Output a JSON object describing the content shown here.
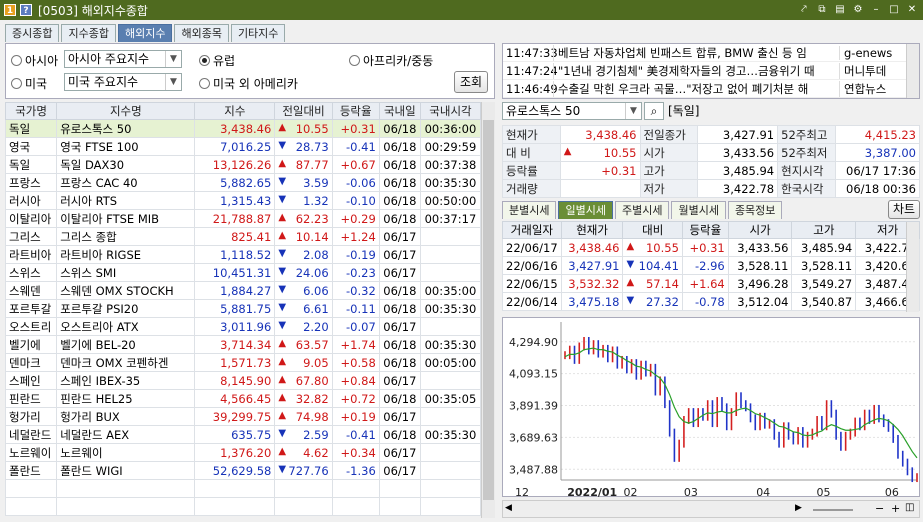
{
  "window": {
    "title": "[0503] 해외지수종합"
  },
  "top_tabs": [
    "증시종합",
    "지수종합",
    "해외지수",
    "해외종목",
    "기타지수"
  ],
  "filters": {
    "asia_label": "아시아",
    "asia_select": "아시아 주요지수",
    "europe_label": "유럽",
    "africa_label": "아프리카/중동",
    "us_label": "미국",
    "us_select": "미국 주요지수",
    "nonus_label": "미국 외 아메리카",
    "query_button": "조회"
  },
  "list_headers": [
    "국가명",
    "지수명",
    "지수",
    "전일대비",
    "등락율",
    "국내일",
    "국내시각"
  ],
  "list_rows": [
    {
      "country": "독일",
      "name": "유로스톡스 50",
      "value": "3,438.46",
      "dir": "up",
      "chg": "10.55",
      "rate": "+0.31",
      "date": "06/18",
      "time": "00:36:00"
    },
    {
      "country": "영국",
      "name": "영국 FTSE 100",
      "value": "7,016.25",
      "dir": "dn",
      "chg": "28.73",
      "rate": "-0.41",
      "date": "06/18",
      "time": "00:29:59"
    },
    {
      "country": "독일",
      "name": "독일 DAX30",
      "value": "13,126.26",
      "dir": "up",
      "chg": "87.77",
      "rate": "+0.67",
      "date": "06/18",
      "time": "00:37:38"
    },
    {
      "country": "프랑스",
      "name": "프랑스 CAC 40",
      "value": "5,882.65",
      "dir": "dn",
      "chg": "3.59",
      "rate": "-0.06",
      "date": "06/18",
      "time": "00:35:30"
    },
    {
      "country": "러시아",
      "name": "러시아 RTS",
      "value": "1,315.43",
      "dir": "dn",
      "chg": "1.32",
      "rate": "-0.10",
      "date": "06/18",
      "time": "00:50:00"
    },
    {
      "country": "이탈리아",
      "name": "이탈리아 FTSE MIB",
      "value": "21,788.87",
      "dir": "up",
      "chg": "62.23",
      "rate": "+0.29",
      "date": "06/18",
      "time": "00:37:17"
    },
    {
      "country": "그리스",
      "name": "그리스 종합",
      "value": "825.41",
      "dir": "up",
      "chg": "10.14",
      "rate": "+1.24",
      "date": "06/17",
      "time": ""
    },
    {
      "country": "라트비아",
      "name": "라트비아 RIGSE",
      "value": "1,118.52",
      "dir": "dn",
      "chg": "2.08",
      "rate": "-0.19",
      "date": "06/17",
      "time": ""
    },
    {
      "country": "스위스",
      "name": "스위스 SMI",
      "value": "10,451.31",
      "dir": "dn",
      "chg": "24.06",
      "rate": "-0.23",
      "date": "06/17",
      "time": ""
    },
    {
      "country": "스웨덴",
      "name": "스웨덴 OMX STOCKH",
      "value": "1,884.27",
      "dir": "dn",
      "chg": "6.06",
      "rate": "-0.32",
      "date": "06/18",
      "time": "00:35:00"
    },
    {
      "country": "포르투갈",
      "name": "포르투갈 PSI20",
      "value": "5,881.75",
      "dir": "dn",
      "chg": "6.61",
      "rate": "-0.11",
      "date": "06/18",
      "time": "00:35:30"
    },
    {
      "country": "오스트리",
      "name": "오스트리아 ATX",
      "value": "3,011.96",
      "dir": "dn",
      "chg": "2.20",
      "rate": "-0.07",
      "date": "06/17",
      "time": ""
    },
    {
      "country": "벨기에",
      "name": "벨기에 BEL-20",
      "value": "3,714.34",
      "dir": "up",
      "chg": "63.57",
      "rate": "+1.74",
      "date": "06/18",
      "time": "00:35:30"
    },
    {
      "country": "덴마크",
      "name": "덴마크 OMX 코펜하겐",
      "value": "1,571.73",
      "dir": "up",
      "chg": "9.05",
      "rate": "+0.58",
      "date": "06/18",
      "time": "00:05:00"
    },
    {
      "country": "스페인",
      "name": "스페인 IBEX-35",
      "value": "8,145.90",
      "dir": "up",
      "chg": "67.80",
      "rate": "+0.84",
      "date": "06/17",
      "time": ""
    },
    {
      "country": "핀란드",
      "name": "핀란드 HEL25",
      "value": "4,566.45",
      "dir": "up",
      "chg": "32.82",
      "rate": "+0.72",
      "date": "06/18",
      "time": "00:35:05"
    },
    {
      "country": "헝가리",
      "name": "헝가리 BUX",
      "value": "39,299.75",
      "dir": "up",
      "chg": "74.98",
      "rate": "+0.19",
      "date": "06/17",
      "time": ""
    },
    {
      "country": "네덜란드",
      "name": "네덜란드 AEX",
      "value": "635.75",
      "dir": "dn",
      "chg": "2.59",
      "rate": "-0.41",
      "date": "06/18",
      "time": "00:35:30"
    },
    {
      "country": "노르웨이",
      "name": "노르웨이",
      "value": "1,376.20",
      "dir": "up",
      "chg": "4.62",
      "rate": "+0.34",
      "date": "06/17",
      "time": ""
    },
    {
      "country": "폴란드",
      "name": "폴란드 WIGI",
      "value": "52,629.58",
      "dir": "dn",
      "chg": "727.76",
      "rate": "-1.36",
      "date": "06/17",
      "time": ""
    }
  ],
  "news": [
    {
      "time": "11:47:33",
      "headline": "베트남 자동차업체 빈패스트 합류, BMW 출신 등 임",
      "source": "g-enews"
    },
    {
      "time": "11:47:24",
      "headline": "\"1년내 경기침체\" 美경제학자들의 경고…금융위기 때",
      "source": "머니투데"
    },
    {
      "time": "11:46:49",
      "headline": "수출길 막힌 우크라 곡물…\"저장고 없어 폐기처분 해",
      "source": "연합뉴스"
    }
  ],
  "search": {
    "value": "유로스톡스 50",
    "market": "[독일]"
  },
  "quote": [
    [
      "현재가",
      "3,438.46",
      "전일종가",
      "3,427.91",
      "52주최고",
      "4,415.23"
    ],
    [
      "대 비",
      "10.55",
      "시가",
      "3,433.56",
      "52주최저",
      "3,387.00"
    ],
    [
      "등락률",
      "+0.31",
      "고가",
      "3,485.94",
      "현지시각",
      "06/17 17:36"
    ],
    [
      "거래량",
      "",
      "저가",
      "3,422.78",
      "한국시각",
      "06/18 00:36"
    ]
  ],
  "sub_tabs": [
    "분별시세",
    "일별시세",
    "주별시세",
    "월별시세",
    "종목정보"
  ],
  "chart_button": "차트",
  "daily_headers": [
    "거래일자",
    "현재가",
    "대비",
    "등락율",
    "시가",
    "고가",
    "저가"
  ],
  "daily_rows": [
    {
      "date": "22/06/17",
      "price": "3,438.46",
      "dir": "up",
      "chg": "10.55",
      "rate": "+0.31",
      "open": "3,433.56",
      "high": "3,485.94",
      "low": "3,422.78"
    },
    {
      "date": "22/06/16",
      "price": "3,427.91",
      "dir": "dn",
      "chg": "104.41",
      "rate": "-2.96",
      "open": "3,528.11",
      "high": "3,528.11",
      "low": "3,420.65"
    },
    {
      "date": "22/06/15",
      "price": "3,532.32",
      "dir": "up",
      "chg": "57.14",
      "rate": "+1.64",
      "open": "3,496.28",
      "high": "3,549.27",
      "low": "3,487.44"
    },
    {
      "date": "22/06/14",
      "price": "3,475.18",
      "dir": "dn",
      "chg": "27.32",
      "rate": "-0.78",
      "open": "3,512.04",
      "high": "3,540.87",
      "low": "3,466.69"
    }
  ],
  "chart_data": {
    "type": "line",
    "y_ticks": [
      "4,294.90",
      "4,093.15",
      "3,891.39",
      "3,689.63",
      "3,487.88"
    ],
    "x_ticks": [
      "12",
      "2022/01",
      "02",
      "03",
      "04",
      "05",
      "06"
    ],
    "ylim": [
      3420,
      4420
    ],
    "series": [
      {
        "values": [
          4210,
          4245,
          4180,
          4265,
          4300,
          4240,
          4280,
          4220,
          4250,
          4190,
          4240,
          4150,
          4180,
          4120,
          4160,
          4080,
          4150,
          4100,
          4130,
          3980,
          4050,
          3900,
          3720,
          3560,
          3650,
          3800,
          3850,
          3780,
          3850,
          3820,
          3900,
          3780,
          3920,
          3880,
          3760,
          3850,
          3950,
          3900,
          3880,
          3810,
          3760,
          3820,
          3770,
          3780,
          3700,
          3650,
          3760,
          3700,
          3670,
          3730,
          3650,
          3700,
          3720,
          3800,
          3760,
          3900,
          3840,
          3700,
          3630,
          3700,
          3720,
          3790,
          3760,
          3840,
          3800,
          3870,
          3810,
          3780,
          3750,
          3680,
          3580,
          3530,
          3475,
          3432,
          3438
        ]
      },
      {
        "values": [
          4200,
          4215,
          4215,
          4225,
          4245,
          4250,
          4255,
          4245,
          4245,
          4235,
          4230,
          4210,
          4195,
          4175,
          4160,
          4140,
          4135,
          4120,
          4110,
          4085,
          4065,
          4025,
          3960,
          3880,
          3820,
          3790,
          3780,
          3790,
          3810,
          3830,
          3845,
          3840,
          3850,
          3855,
          3845,
          3845,
          3860,
          3870,
          3875,
          3860,
          3840,
          3830,
          3815,
          3800,
          3780,
          3760,
          3755,
          3740,
          3725,
          3720,
          3705,
          3700,
          3705,
          3720,
          3730,
          3755,
          3770,
          3760,
          3745,
          3735,
          3735,
          3740,
          3745,
          3770,
          3785,
          3800,
          3810,
          3805,
          3795,
          3770,
          3740,
          3700,
          3650,
          3600,
          3560
        ]
      }
    ]
  }
}
